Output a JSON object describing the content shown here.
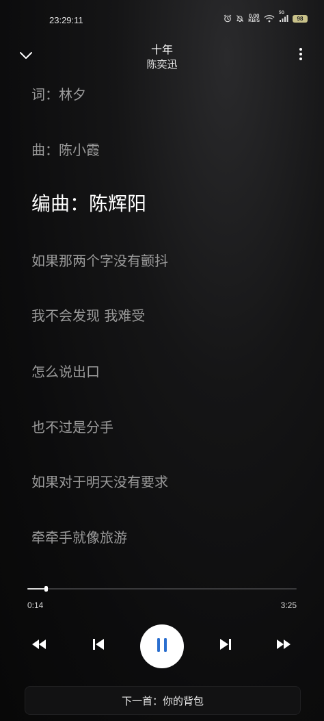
{
  "status_bar": {
    "time": "23:29:11",
    "net_speed_value": "0.00",
    "net_speed_unit": "KB/S",
    "signal_label": "5G",
    "battery": "98"
  },
  "header": {
    "title": "十年",
    "artist": "陈奕迅"
  },
  "lyrics": [
    {
      "text": "词：林夕",
      "active": false
    },
    {
      "text": "曲：陈小霞",
      "active": false
    },
    {
      "text": "编曲：陈辉阳",
      "active": true
    },
    {
      "text": "如果那两个字没有颤抖",
      "active": false
    },
    {
      "text": "我不会发现 我难受",
      "active": false
    },
    {
      "text": "怎么说出口",
      "active": false
    },
    {
      "text": "也不过是分手",
      "active": false
    },
    {
      "text": "如果对于明天没有要求",
      "active": false
    },
    {
      "text": "牵牵手就像旅游",
      "active": false
    }
  ],
  "player": {
    "current_time": "0:14",
    "total_time": "3:25",
    "progress_fraction": 0.068,
    "next_song_label": "下一首：你的背包"
  },
  "colors": {
    "play_icon": "#2b6fcf",
    "active_lyric": "#ffffff",
    "inactive_lyric": "#9a9a9a"
  },
  "icons": [
    "alarm-icon",
    "mute-icon",
    "wifi-icon",
    "signal-icon",
    "battery-icon",
    "chevron-down-icon",
    "more-vert-icon",
    "rewind-icon",
    "previous-icon",
    "pause-icon",
    "next-icon",
    "fast-forward-icon"
  ]
}
